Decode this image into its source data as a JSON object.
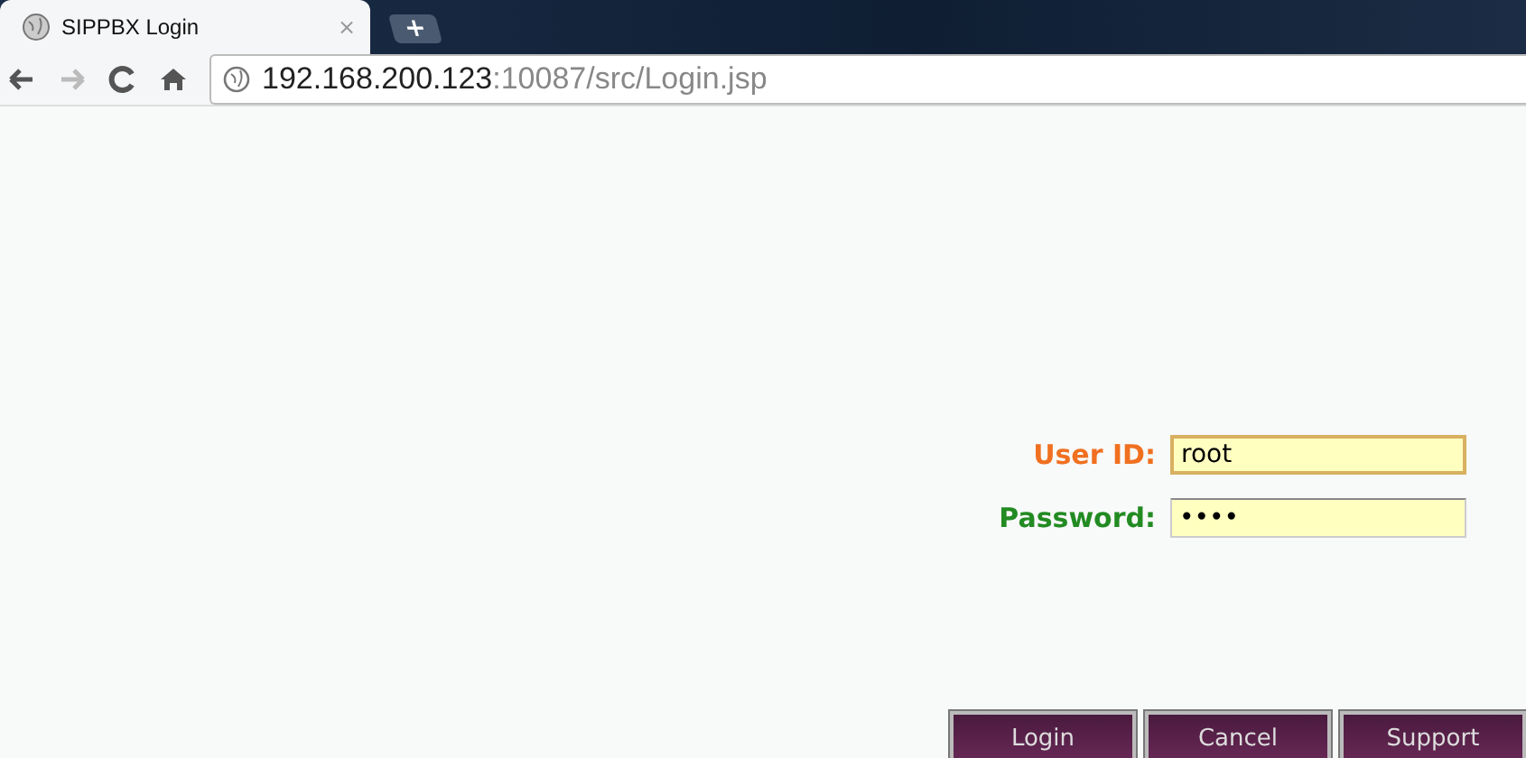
{
  "tab": {
    "title": "SIPPBX Login",
    "close": "×",
    "new_tab": "+"
  },
  "address": {
    "host": "192.168.200.123",
    "rest": ":10087/src/Login.jsp"
  },
  "form": {
    "fields": [
      {
        "label": "User ID:",
        "value": "root",
        "color": "#f07020",
        "focused": true
      },
      {
        "label": "Password:",
        "value": "••••",
        "color": "#228b22",
        "focused": false
      }
    ]
  },
  "buttons": [
    "Login",
    "Cancel",
    "Support"
  ]
}
